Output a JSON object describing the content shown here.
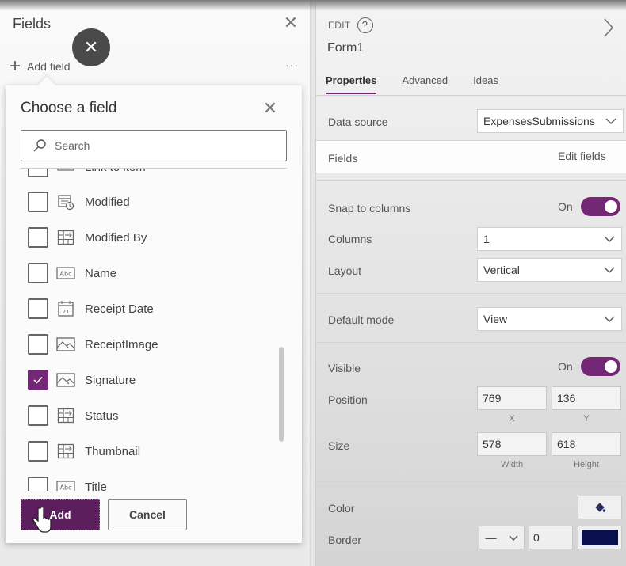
{
  "left_panel": {
    "title": "Fields",
    "add_field_label": "Add field",
    "more_label": "···"
  },
  "chooser": {
    "title": "Choose a field",
    "search_placeholder": "Search",
    "items": [
      {
        "label": "Link to item",
        "icon": "link-field-icon",
        "checked": false
      },
      {
        "label": "Modified",
        "icon": "datetime-field-icon",
        "checked": false
      },
      {
        "label": "Modified By",
        "icon": "lookup-field-icon",
        "checked": false
      },
      {
        "label": "Name",
        "icon": "text-field-icon",
        "checked": false
      },
      {
        "label": "Receipt Date",
        "icon": "calendar-field-icon",
        "checked": false
      },
      {
        "label": "ReceiptImage",
        "icon": "image-field-icon",
        "checked": false
      },
      {
        "label": "Signature",
        "icon": "image-field-icon",
        "checked": true
      },
      {
        "label": "Status",
        "icon": "lookup-field-icon",
        "checked": false
      },
      {
        "label": "Thumbnail",
        "icon": "lookup-field-icon",
        "checked": false
      },
      {
        "label": "Title",
        "icon": "text-field-icon",
        "checked": false
      }
    ],
    "add_label": "Add",
    "cancel_label": "Cancel"
  },
  "props": {
    "edit_label": "EDIT",
    "control_name": "Form1",
    "tabs": [
      {
        "label": "Properties",
        "active": true
      },
      {
        "label": "Advanced",
        "active": false
      },
      {
        "label": "Ideas",
        "active": false
      }
    ],
    "data_source_label": "Data source",
    "data_source_value": "ExpensesSubmissions",
    "fields_label": "Fields",
    "edit_fields_label": "Edit fields",
    "snap_label": "Snap to columns",
    "snap_value": "On",
    "columns_label": "Columns",
    "columns_value": "1",
    "layout_label": "Layout",
    "layout_value": "Vertical",
    "default_mode_label": "Default mode",
    "default_mode_value": "View",
    "visible_label": "Visible",
    "visible_value": "On",
    "position_label": "Position",
    "position_x": "769",
    "position_y": "136",
    "x_label": "X",
    "y_label": "Y",
    "size_label": "Size",
    "size_width": "578",
    "size_height": "618",
    "width_label": "Width",
    "height_label": "Height",
    "color_label": "Color",
    "border_label": "Border",
    "border_style": "—",
    "border_width": "0",
    "border_color": "#0a0f4f"
  },
  "colors": {
    "accent": "#742774",
    "add_button": "#5c1e5c"
  }
}
